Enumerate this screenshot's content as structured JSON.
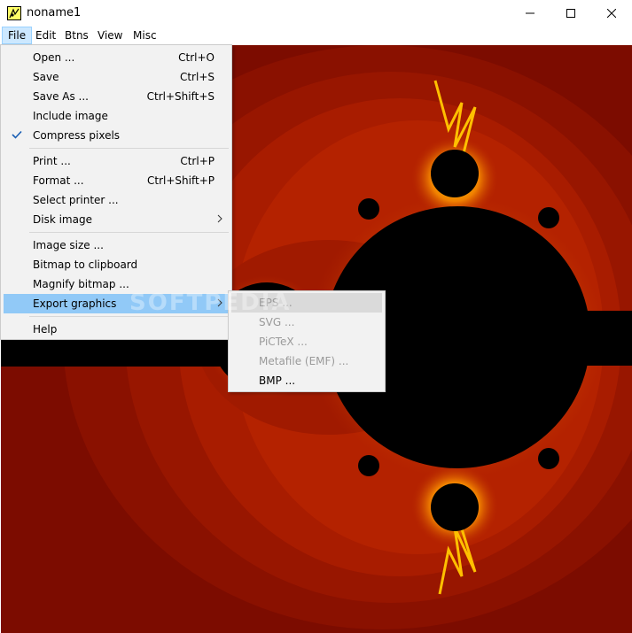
{
  "window": {
    "title": "noname1"
  },
  "menubar": [
    {
      "label": "File",
      "active": true
    },
    {
      "label": "Edit"
    },
    {
      "label": "Btns"
    },
    {
      "label": "View"
    },
    {
      "label": "Misc"
    }
  ],
  "file_menu": [
    {
      "label": "Open ...",
      "shortcut": "Ctrl+O"
    },
    {
      "label": "Save",
      "shortcut": "Ctrl+S"
    },
    {
      "label": "Save As ...",
      "shortcut": "Ctrl+Shift+S"
    },
    {
      "label": "Include image"
    },
    {
      "label": "Compress pixels",
      "checked": true
    },
    {
      "label": "Print ...",
      "shortcut": "Ctrl+P"
    },
    {
      "label": "Format ...",
      "shortcut": "Ctrl+Shift+P"
    },
    {
      "label": "Select printer ..."
    },
    {
      "label": "Disk image",
      "submenu": true
    },
    {
      "label": "Image size ..."
    },
    {
      "label": "Bitmap to clipboard"
    },
    {
      "label": "Magnify bitmap ..."
    },
    {
      "label": "Export graphics",
      "submenu": true,
      "highlighted": true
    },
    {
      "label": "Help"
    }
  ],
  "export_submenu": [
    {
      "label": "EPS ...",
      "enabled": false,
      "highlighted": true
    },
    {
      "label": "SVG ...",
      "enabled": false
    },
    {
      "label": "PiCTeX ...",
      "enabled": false
    },
    {
      "label": "Metafile (EMF) ...",
      "enabled": false
    },
    {
      "label": "BMP ...",
      "enabled": true
    }
  ],
  "watermark": "SOFTPEDIA",
  "colors": {
    "background_fractal": "#7c0c00",
    "fractal_edge": "#f5a000",
    "menu_highlight": "#91c9f7",
    "menubar_active": "#cce8ff"
  },
  "icons": {
    "app": "fractal-app-icon",
    "minimize": "minimize-icon",
    "maximize": "maximize-icon",
    "close": "close-icon",
    "check": "checkmark-icon",
    "submenu_arrow": "chevron-right-icon"
  }
}
